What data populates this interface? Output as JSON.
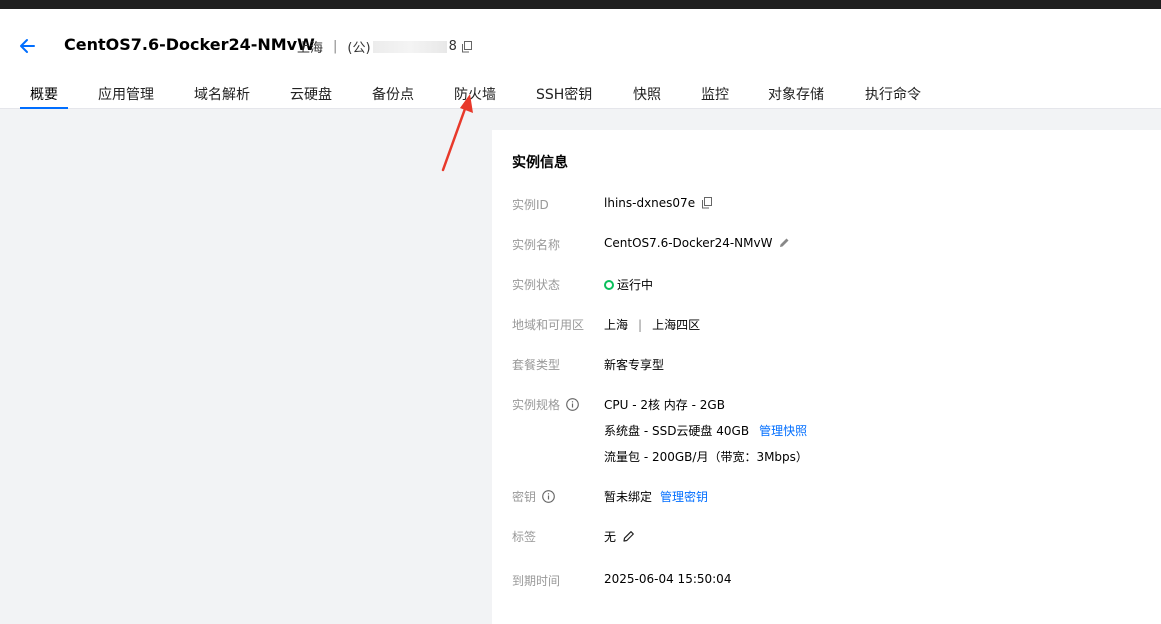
{
  "header": {
    "title": "CentOS7.6-Docker24-NMvW",
    "region": "上海",
    "separator": "|",
    "ip_prefix": "(公) ",
    "ip_suffix": "8"
  },
  "tabs": [
    {
      "label": "概要"
    },
    {
      "label": "应用管理"
    },
    {
      "label": "域名解析"
    },
    {
      "label": "云硬盘"
    },
    {
      "label": "备份点"
    },
    {
      "label": "防火墙"
    },
    {
      "label": "SSH密钥"
    },
    {
      "label": "快照"
    },
    {
      "label": "监控"
    },
    {
      "label": "对象存储"
    },
    {
      "label": "执行命令"
    }
  ],
  "panel": {
    "title": "实例信息",
    "rows": {
      "id": {
        "label": "实例ID",
        "value": "lhins-dxnes07e"
      },
      "name": {
        "label": "实例名称",
        "value": "CentOS7.6-Docker24-NMvW"
      },
      "status": {
        "label": "实例状态",
        "value": "运行中"
      },
      "region": {
        "label": "地域和可用区",
        "value_region": "上海",
        "separator": "|",
        "value_zone": "上海四区"
      },
      "package": {
        "label": "套餐类型",
        "value": "新客专享型"
      },
      "spec": {
        "label": "实例规格",
        "cpu": "CPU - 2核 内存 - 2GB",
        "disk": "系统盘 - SSD云硬盘 40GB",
        "disk_link": "管理快照",
        "traffic": "流量包 - 200GB/月（带宽：3Mbps）"
      },
      "key": {
        "label": "密钥",
        "value": "暂未绑定",
        "link": "管理密钥"
      },
      "tags": {
        "label": "标签",
        "value": "无"
      },
      "expire": {
        "label": "到期时间",
        "value": "2025-06-04 15:50:04"
      }
    }
  },
  "colors": {
    "accent": "#006eff",
    "status_running": "#0abf5b",
    "annotation_arrow": "#e8392b"
  }
}
